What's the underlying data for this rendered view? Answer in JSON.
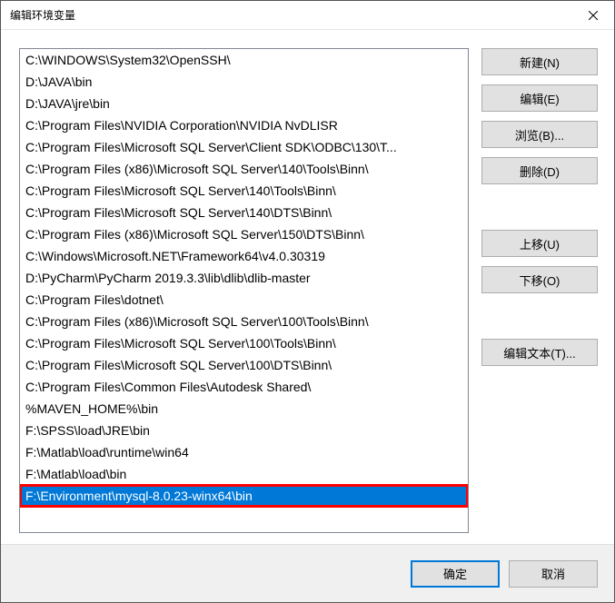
{
  "window": {
    "title": "编辑环境变量"
  },
  "list": {
    "items": [
      "C:\\WINDOWS\\System32\\OpenSSH\\",
      "D:\\JAVA\\bin",
      "D:\\JAVA\\jre\\bin",
      "C:\\Program Files\\NVIDIA Corporation\\NVIDIA NvDLISR",
      "C:\\Program Files\\Microsoft SQL Server\\Client SDK\\ODBC\\130\\T...",
      "C:\\Program Files (x86)\\Microsoft SQL Server\\140\\Tools\\Binn\\",
      "C:\\Program Files\\Microsoft SQL Server\\140\\Tools\\Binn\\",
      "C:\\Program Files\\Microsoft SQL Server\\140\\DTS\\Binn\\",
      "C:\\Program Files (x86)\\Microsoft SQL Server\\150\\DTS\\Binn\\",
      "C:\\Windows\\Microsoft.NET\\Framework64\\v4.0.30319",
      "D:\\PyCharm\\PyCharm 2019.3.3\\lib\\dlib\\dlib-master",
      "C:\\Program Files\\dotnet\\",
      "C:\\Program Files (x86)\\Microsoft SQL Server\\100\\Tools\\Binn\\",
      "C:\\Program Files\\Microsoft SQL Server\\100\\Tools\\Binn\\",
      "C:\\Program Files\\Microsoft SQL Server\\100\\DTS\\Binn\\",
      "C:\\Program Files\\Common Files\\Autodesk Shared\\",
      "%MAVEN_HOME%\\bin",
      "F:\\SPSS\\load\\JRE\\bin",
      "F:\\Matlab\\load\\runtime\\win64",
      "F:\\Matlab\\load\\bin",
      "F:\\Environment\\mysql-8.0.23-winx64\\bin"
    ],
    "selected_index": 20,
    "highlighted_index": 20
  },
  "side_buttons": {
    "new": "新建(N)",
    "edit": "编辑(E)",
    "browse": "浏览(B)...",
    "delete": "删除(D)",
    "move_up": "上移(U)",
    "move_down": "下移(O)",
    "edit_text": "编辑文本(T)..."
  },
  "footer": {
    "ok": "确定",
    "cancel": "取消"
  }
}
